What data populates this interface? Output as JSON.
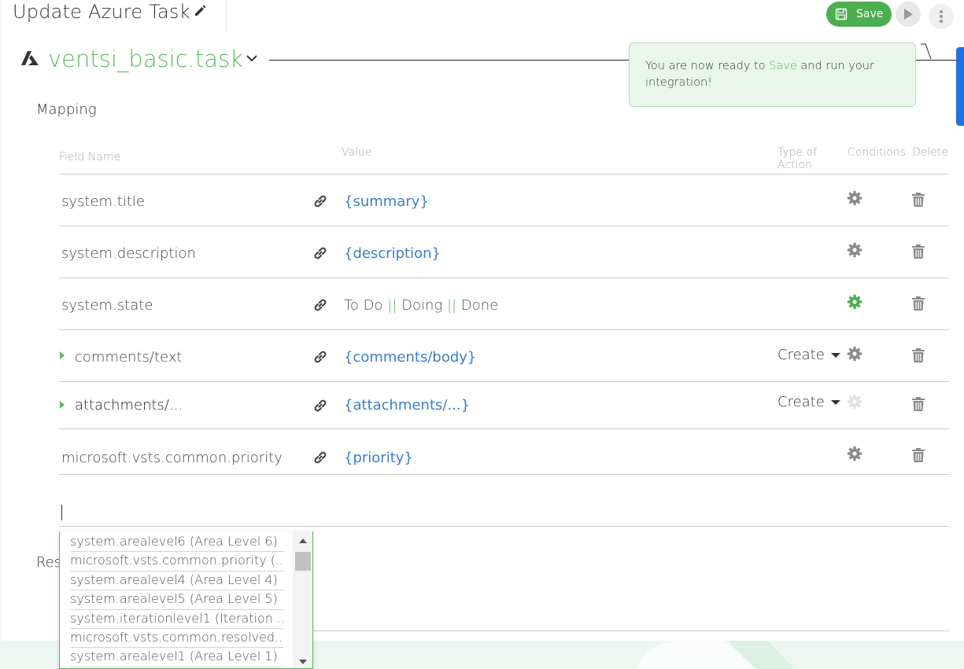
{
  "header": {
    "title": "Update Azure Task",
    "save_label": "Save"
  },
  "task": {
    "name": "ventsi_basic.task"
  },
  "tooltip": {
    "text_before": "You are now ready to ",
    "text_accent": "Save",
    "text_after": " and run your integration!"
  },
  "mapping": {
    "section_title": "Mapping",
    "columns": {
      "field_name": "Field Name",
      "value": "Value",
      "type_of_action": "Type of Action",
      "conditions": "Conditions",
      "delete": "Delete"
    },
    "rows": [
      {
        "field": "system.title",
        "value": "{summary}",
        "value_style": "link",
        "expandable": false,
        "action": "",
        "gear_color": "#8a8a8a"
      },
      {
        "field": "system.description",
        "value": "{description}",
        "value_style": "link",
        "expandable": false,
        "action": "",
        "gear_color": "#8a8a8a"
      },
      {
        "field": "system.state",
        "value_parts": [
          "To Do",
          "||",
          "Doing",
          "||",
          "Done"
        ],
        "value_style": "plain",
        "expandable": false,
        "action": "",
        "gear_color": "#4cae4f"
      },
      {
        "field": "comments/text",
        "value": "{comments/body}",
        "value_style": "link",
        "expandable": true,
        "action": "Create",
        "gear_color": "#8a8a8a"
      },
      {
        "field": "attachments/...",
        "value": "{attachments/...}",
        "value_style": "link",
        "expandable": true,
        "action": "Create",
        "gear_color": "#e2e2e2"
      },
      {
        "field": "microsoft.vsts.common.priority",
        "value": "{priority}",
        "value_style": "link",
        "expandable": false,
        "action": "",
        "gear_color": "#8a8a8a"
      }
    ]
  },
  "new_field": {
    "value": ""
  },
  "res_label": "Res",
  "dropdown": {
    "options": [
      "system.arealevel6 (Area Level 6)",
      "microsoft.vsts.common.priority (...",
      "system.arealevel4 (Area Level 4)",
      "system.arealevel5 (Area Level 5)",
      "system.iterationlevel1 (Iteration ...",
      "microsoft.vsts.common.resolved...",
      "system.arealevel1 (Area Level 1)"
    ]
  },
  "colors": {
    "accent_green": "#5cb85c",
    "save_green": "#4cae4f",
    "link_blue": "#3b7fc4",
    "scroll_blue": "#1a73e8"
  }
}
